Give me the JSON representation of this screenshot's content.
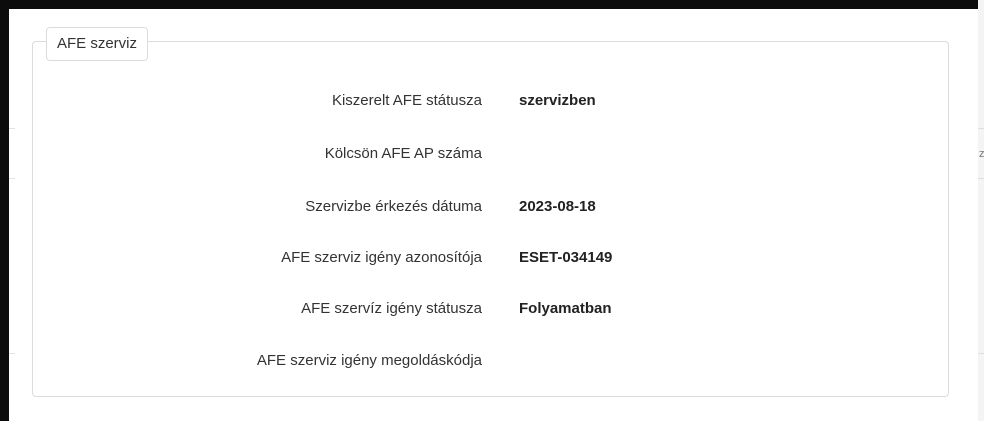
{
  "panel": {
    "legend": "AFE szerviz"
  },
  "fields": [
    {
      "label": "Kiszerelt AFE státusza",
      "value": "szervizben"
    },
    {
      "label": "Kölcsön AFE AP száma",
      "value": ""
    },
    {
      "label": "Szervizbe érkezés dátuma",
      "value": "2023-08-18"
    },
    {
      "label": "AFE szerviz igény azonosítója",
      "value": "ESET-034149"
    },
    {
      "label": "AFE szervíz igény státusza",
      "value": "Folyamatban"
    },
    {
      "label": "AFE szerviz igény megoldáskódja",
      "value": ""
    }
  ],
  "background": {
    "edge_glyph": "z"
  }
}
